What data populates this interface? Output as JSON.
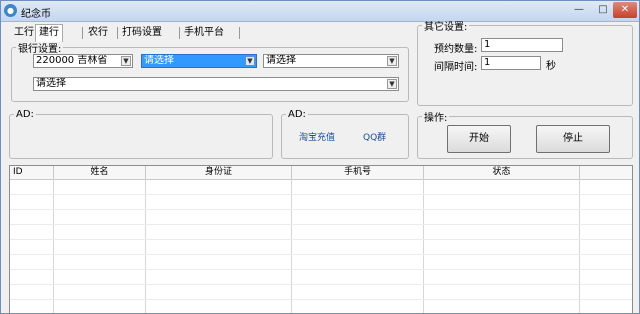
{
  "window": {
    "title": "纪念币"
  },
  "tabs": [
    "工行",
    "建行",
    "农行",
    "打码设置",
    "手机平台"
  ],
  "bank_settings": {
    "legend": "银行设置:",
    "branch_select": "220000 吉林省",
    "city_select": "请选择",
    "district_select": "请选择",
    "outlet_select": "请选择"
  },
  "other_settings": {
    "legend": "其它设置:",
    "quantity_label": "预约数量:",
    "quantity_value": "1",
    "interval_label": "间隔时间:",
    "interval_value": "1",
    "interval_unit": "秒"
  },
  "ad_left": {
    "legend": "AD:"
  },
  "ad_right": {
    "legend": "AD:",
    "link1": "淘宝充值",
    "link2": "QQ群"
  },
  "operations": {
    "legend": "操作:",
    "start_label": "开始",
    "stop_label": "停止"
  },
  "table": {
    "columns": [
      "ID",
      "姓名",
      "身份证",
      "手机号",
      "状态"
    ]
  }
}
